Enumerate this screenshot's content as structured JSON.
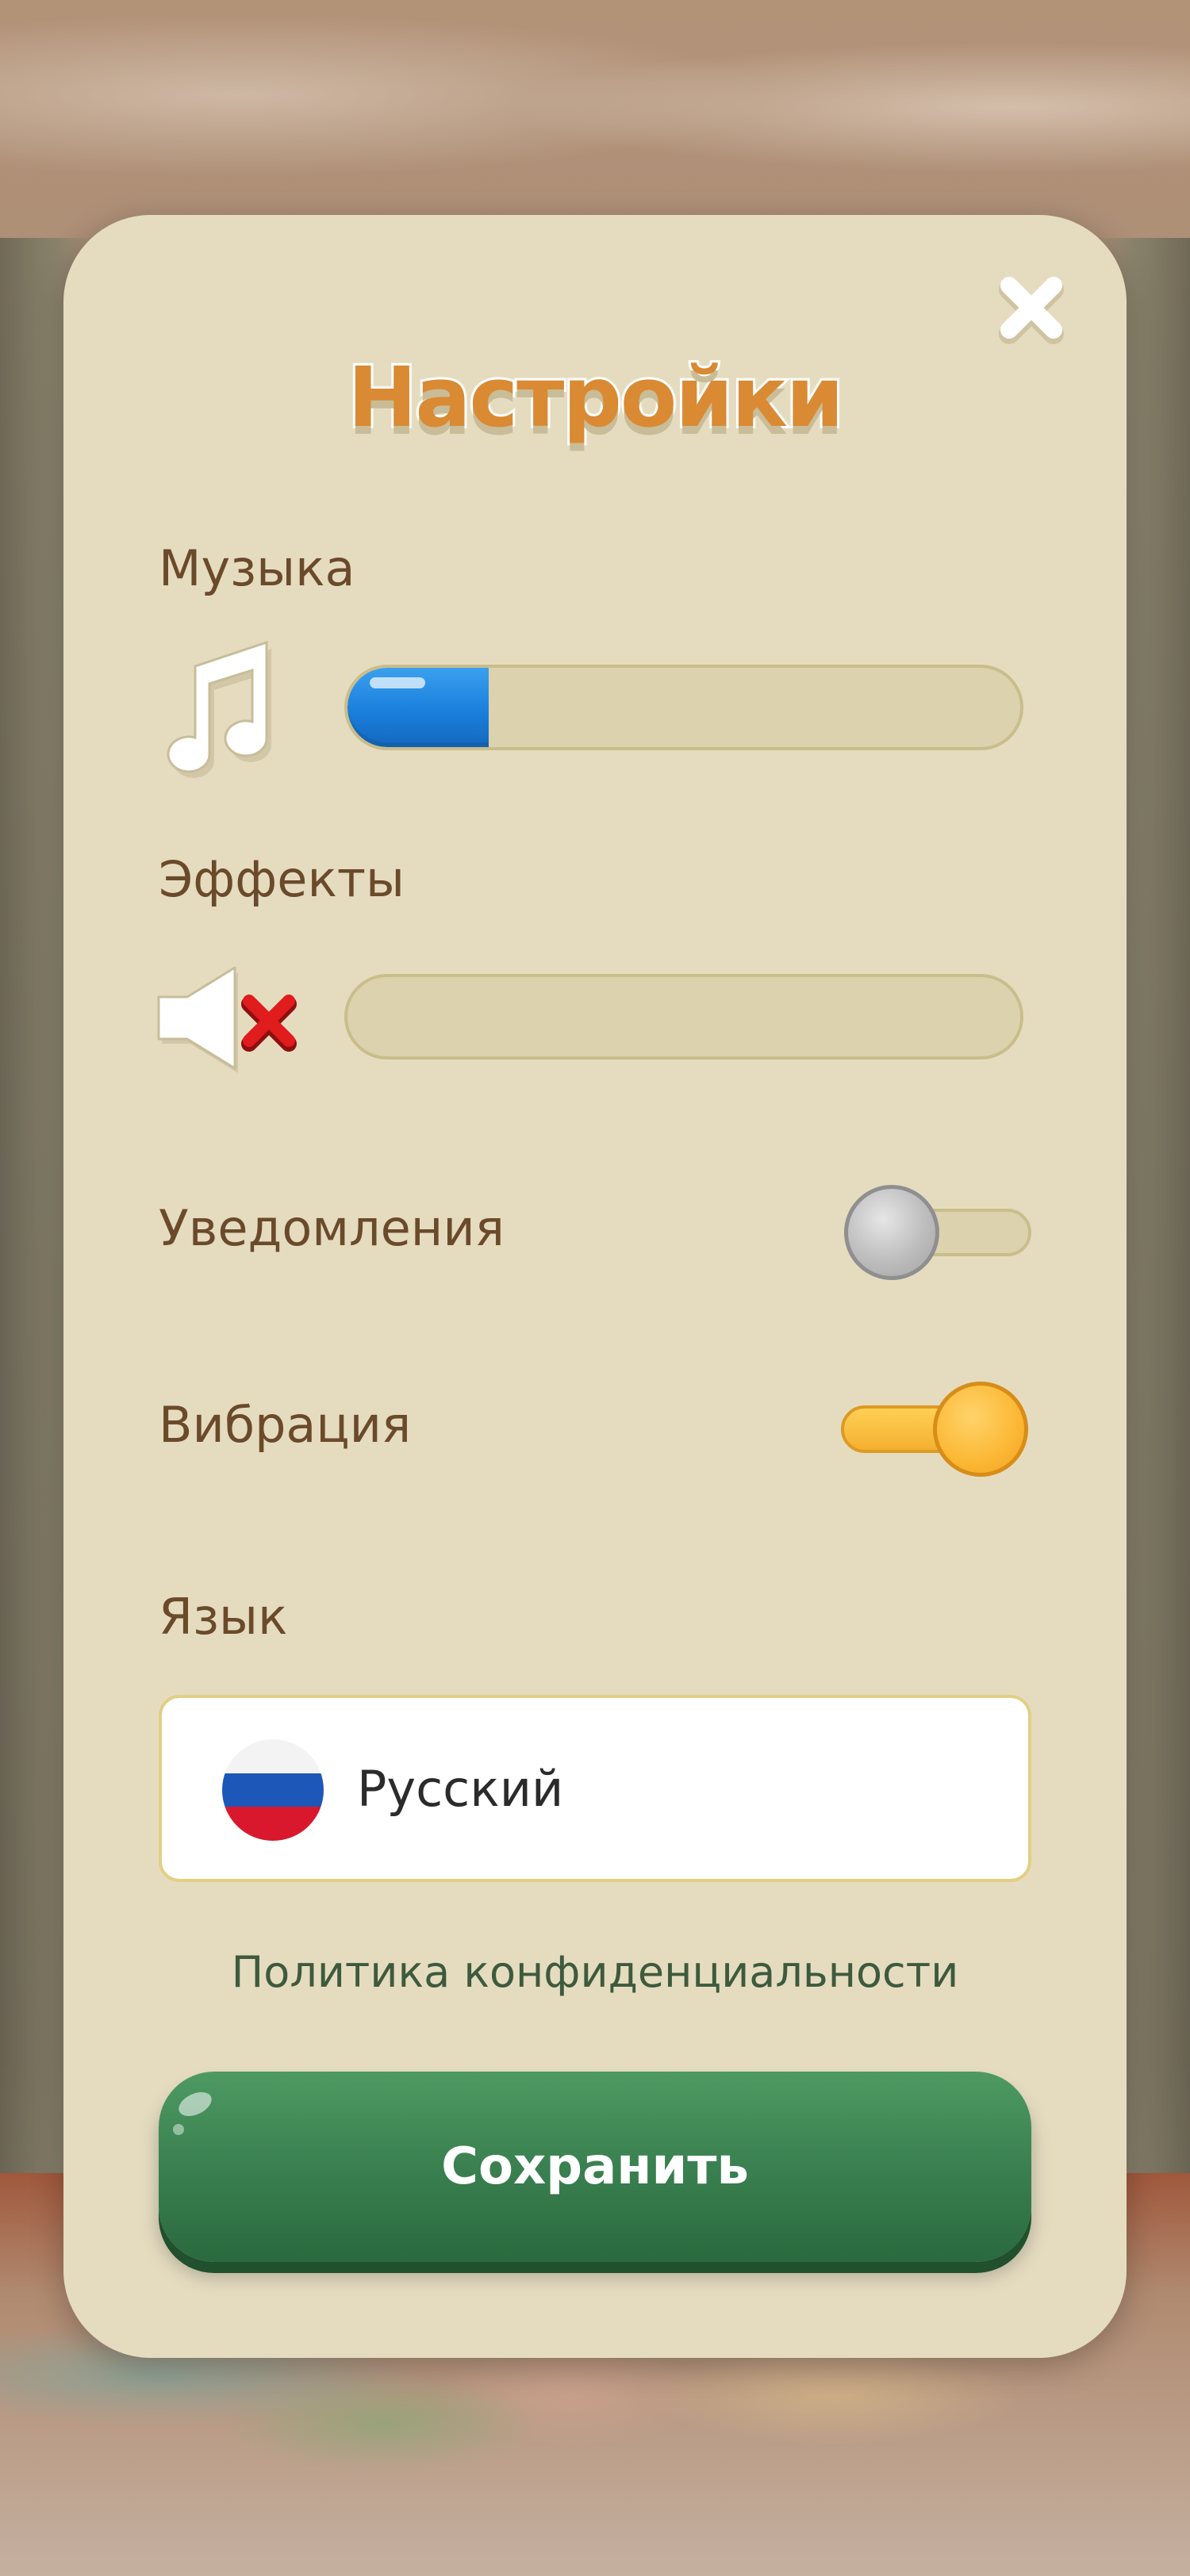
{
  "dialog": {
    "title": "Настройки",
    "close_icon": "close-icon"
  },
  "music": {
    "label": "Музыка",
    "icon": "music-note-icon",
    "level_percent": 21
  },
  "effects": {
    "label": "Эффекты",
    "icon": "speaker-muted-icon",
    "level_percent": 0
  },
  "notifications": {
    "label": "Уведомления",
    "enabled": false
  },
  "vibration": {
    "label": "Вибрация",
    "enabled": true
  },
  "language": {
    "label": "Язык",
    "selected": "Русский",
    "flag_icon": "russia-flag-icon"
  },
  "privacy_link": "Политика конфиденциальности",
  "save_button": "Сохранить",
  "colors": {
    "panel": "#e5dcc0",
    "title": "#d98a32",
    "label": "#6b4a2b",
    "slider_fill": "#1a7fdc",
    "toggle_on": "#fbb835",
    "toggle_off": "#bdbdbd",
    "save_button": "#3a8050",
    "privacy_link": "#3e5a3c"
  }
}
